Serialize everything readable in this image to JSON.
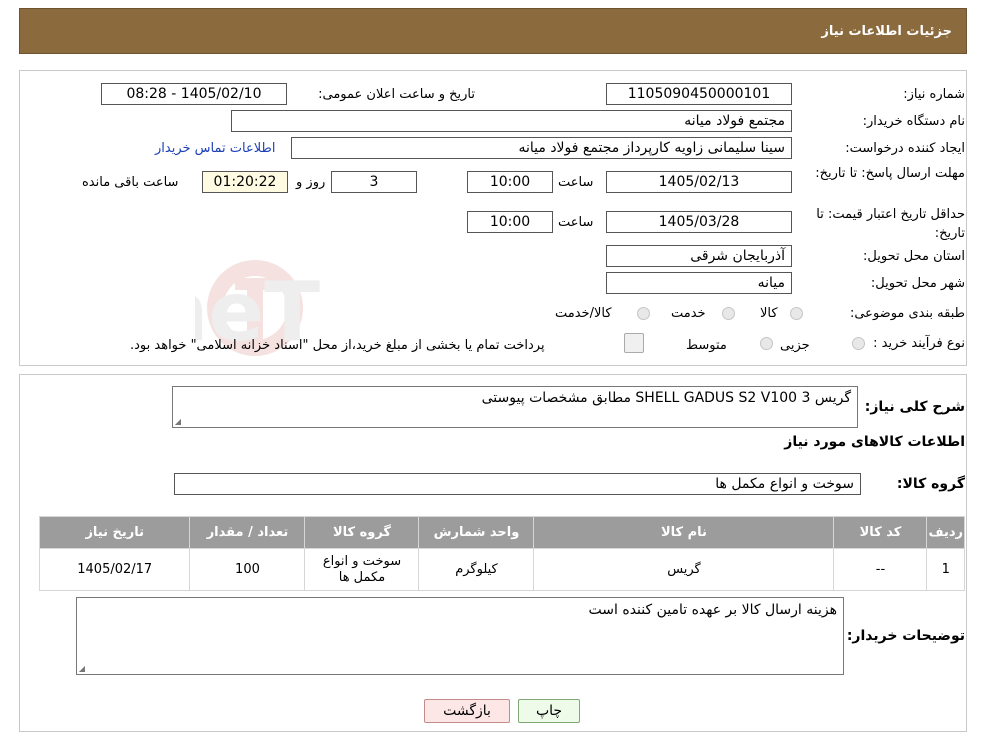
{
  "header": {
    "title": "جزئیات اطلاعات نیاز"
  },
  "need_info": {
    "need_number_label": "شماره نیاز:",
    "need_number": "1105090450000101",
    "announce_label": "تاریخ و ساعت اعلان عمومی:",
    "announce_value": "1405/02/10 - 08:28",
    "buyer_org_label": "نام دستگاه خریدار:",
    "buyer_org": "مجتمع فولاد میانه",
    "requester_label": "ایجاد کننده درخواست:",
    "requester": "سینا سلیمانی زاویه کارپرداز مجتمع فولاد میانه",
    "contact_link": "اطلاعات تماس خریدار",
    "reply_deadline_label": "مهلت ارسال پاسخ: تا تاریخ:",
    "reply_date": "1405/02/13",
    "time_label": "ساعت",
    "reply_time": "10:00",
    "days_value": "3",
    "days_label": "روز و",
    "remaining_time": "01:20:22",
    "remaining_label": "ساعت باقی مانده",
    "price_validity_label": "حداقل تاریخ اعتبار قیمت: تا تاریخ:",
    "price_validity_date": "1405/03/28",
    "price_validity_time": "10:00",
    "province_label": "استان محل تحویل:",
    "province": "آذربایجان شرقی",
    "city_label": "شهر محل تحویل:",
    "city": "میانه",
    "category_label": "طبقه بندی موضوعی:",
    "category_options": [
      "کالا",
      "خدمت",
      "کالا/خدمت"
    ],
    "process_label": "نوع فرآیند خرید :",
    "process_options": [
      "جزیی",
      "متوسط"
    ],
    "payment_note": "پرداخت تمام یا بخشی از مبلغ خرید،از محل \"اسناد خزانه اسلامی\" خواهد بود."
  },
  "description": {
    "label": "شرح کلی نیاز:",
    "value": "گریس SHELL GADUS S2 V100 3 مطابق مشخصات پیوستی"
  },
  "goods_section": {
    "title": "اطلاعات کالاهای مورد نیاز"
  },
  "goods_group": {
    "label": "گروه کالا:",
    "value": "سوخت و انواع مکمل ها"
  },
  "table": {
    "headers": [
      "ردیف",
      "کد کالا",
      "نام کالا",
      "واحد شمارش",
      "گروه کالا",
      "تعداد / مقدار",
      "تاریخ نیاز"
    ],
    "rows": [
      [
        "1",
        "--",
        "گریس",
        "کیلوگرم",
        "سوخت و انواع مکمل ها",
        "100",
        "1405/02/17"
      ]
    ]
  },
  "buyer_notes": {
    "label": "توضیحات خریدار:",
    "value": "هزینه ارسال کالا بر عهده تامین کننده است"
  },
  "buttons": {
    "print": "چاپ",
    "back": "بازگشت"
  },
  "watermark": {
    "text": "AriaTender.neT"
  }
}
